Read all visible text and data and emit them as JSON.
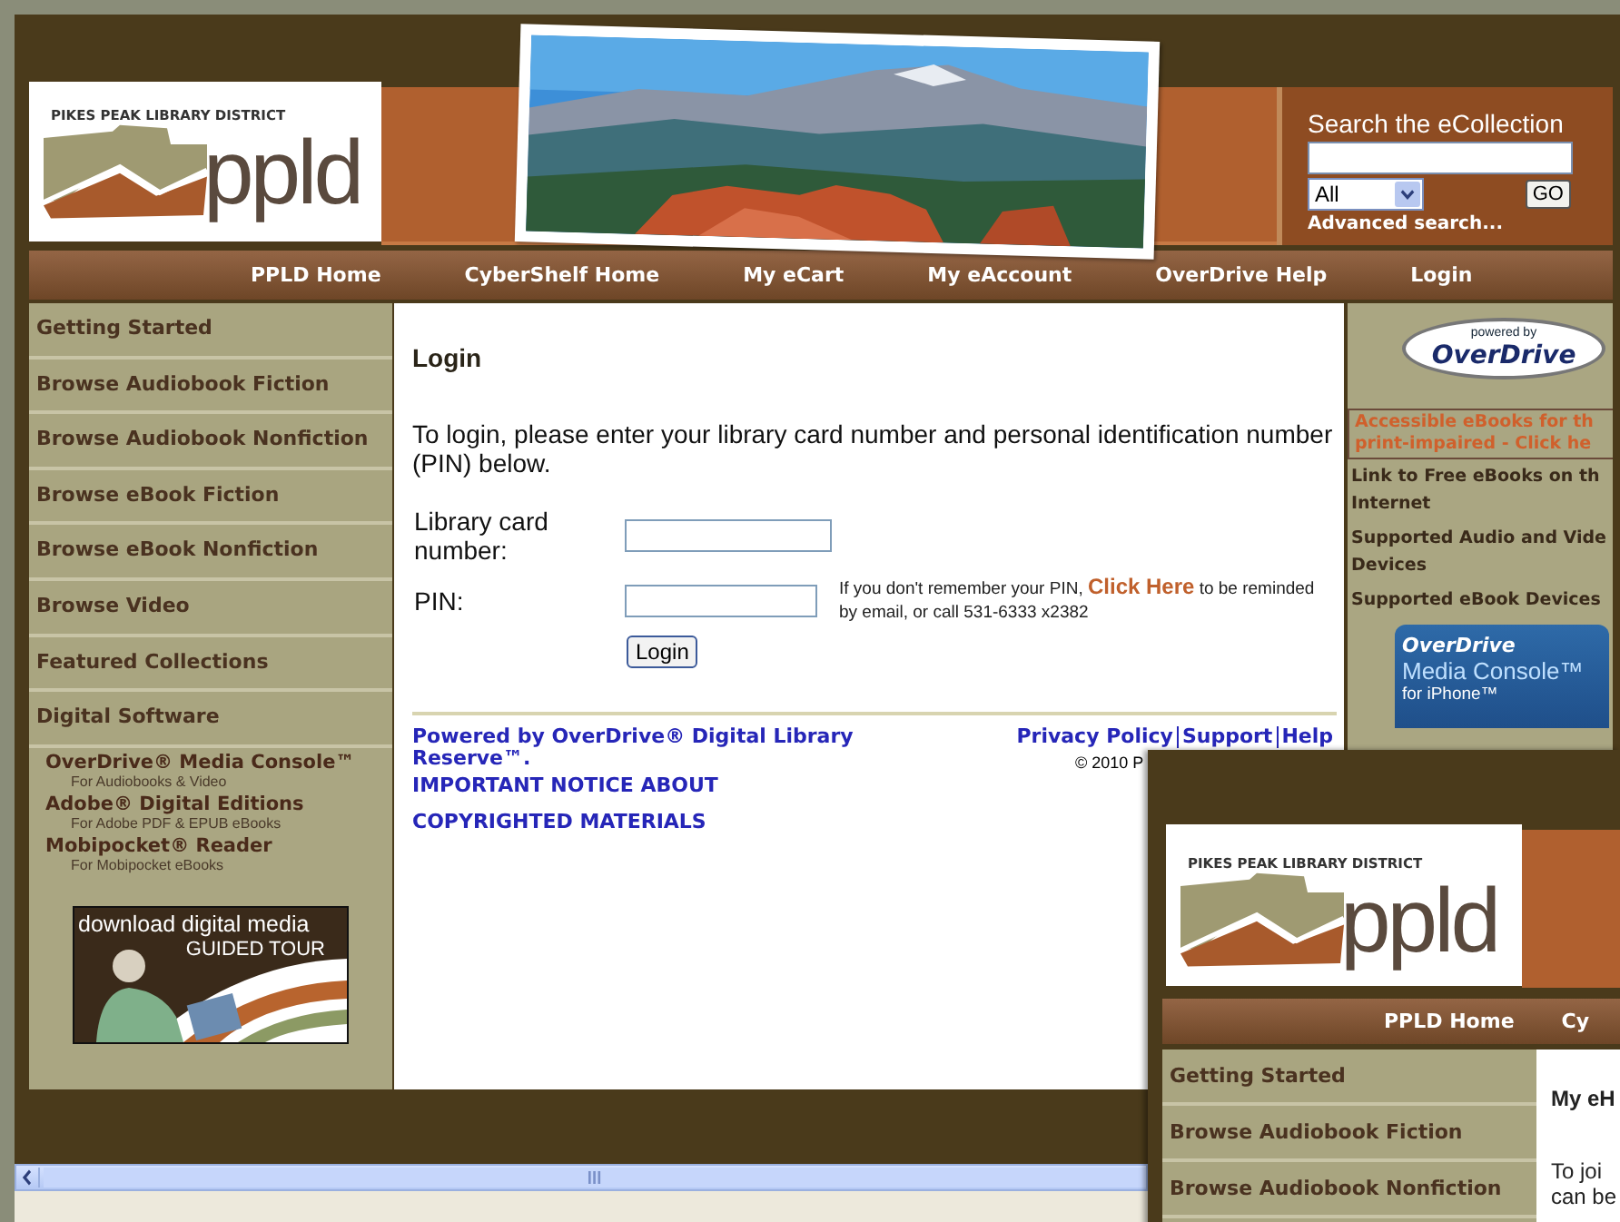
{
  "header": {
    "district": "PIKES PEAK LIBRARY DISTRICT",
    "wordmark": "ppld",
    "search": {
      "title": "Search the eCollection",
      "format": "All",
      "button": "GO",
      "advanced": "Advanced search..."
    }
  },
  "nav": [
    {
      "label": "PPLD Home"
    },
    {
      "label": "CyberShelf Home"
    },
    {
      "label": "My eCart"
    },
    {
      "label": "My eAccount"
    },
    {
      "label": "OverDrive Help"
    },
    {
      "label": "Login"
    }
  ],
  "sidebar": {
    "items": [
      {
        "label": "Getting Started"
      },
      {
        "label": "Browse Audiobook Fiction"
      },
      {
        "label": "Browse Audiobook Nonfiction"
      },
      {
        "label": "Browse eBook Fiction"
      },
      {
        "label": "Browse eBook Nonfiction"
      },
      {
        "label": "Browse Video"
      },
      {
        "label": "Featured Collections"
      },
      {
        "label": "Digital Software"
      }
    ],
    "software": [
      {
        "title": "OverDrive® Media Console™",
        "subtitle": "For Audiobooks & Video"
      },
      {
        "title": "Adobe® Digital Editions",
        "subtitle": "For Adobe PDF & EPUB eBooks"
      },
      {
        "title": "Mobipocket® Reader",
        "subtitle": "For Mobipocket eBooks"
      }
    ],
    "tour": [
      "download digital media",
      "GUIDED TOUR"
    ]
  },
  "login": {
    "title": "Login",
    "intro": "To login, please enter your library card number and personal identification number (PIN) below.",
    "fields": [
      {
        "label": "Library card number:"
      },
      {
        "label": "PIN:"
      }
    ],
    "reminder": {
      "before": "If you don't remember your PIN,",
      "link": "Click Here",
      "after": "to be reminded by email, or call 531-6333 x2382"
    },
    "button": "Login"
  },
  "footer": {
    "powered": "Powered by OverDrive® Digital Library Reserve™.",
    "notice": "IMPORTANT NOTICE ABOUT COPYRIGHTED MATERIALS",
    "links": [
      "Privacy Policy",
      "Support",
      "Help"
    ],
    "copyright": "© 2010 P"
  },
  "right": {
    "badge": {
      "small": "powered by",
      "brand": "OverDrive"
    },
    "accessible": [
      "Accessible eBooks for th",
      "print-impaired - Click he"
    ],
    "links": [
      [
        "Link to Free eBooks on th",
        "Internet"
      ],
      [
        "Supported Audio and Vide",
        "Devices"
      ],
      [
        "Supported eBook Devices"
      ]
    ],
    "ad": {
      "brand": "OverDrive",
      "product": "Media Console™",
      "platform": "for iPhone™"
    }
  },
  "window2": {
    "district": "PIKES PEAK LIBRARY DISTRICT",
    "wordmark": "ppld",
    "nav": [
      "PPLD Home",
      "Cy"
    ],
    "sidebar": [
      "Getting Started",
      "Browse Audiobook Fiction",
      "Browse Audiobook Nonfiction"
    ],
    "heading": "My eH",
    "intro": [
      "To joi",
      "can be"
    ]
  }
}
